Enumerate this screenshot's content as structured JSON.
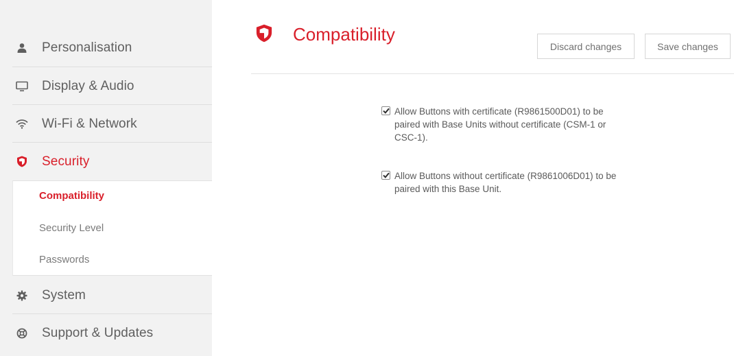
{
  "sidebar": {
    "items": [
      {
        "label": "Personalisation",
        "icon": "person-icon"
      },
      {
        "label": "Display & Audio",
        "icon": "monitor-icon"
      },
      {
        "label": "Wi-Fi & Network",
        "icon": "wifi-icon"
      },
      {
        "label": "Security",
        "icon": "shield-icon"
      },
      {
        "label": "System",
        "icon": "gear-icon"
      },
      {
        "label": "Support & Updates",
        "icon": "lifebuoy-icon"
      }
    ],
    "active": "Security",
    "subitems": [
      {
        "label": "Compatibility"
      },
      {
        "label": "Security Level"
      },
      {
        "label": "Passwords"
      }
    ],
    "active_subitem": "Compatibility"
  },
  "main": {
    "title": "Compatibility",
    "discard_label": "Discard changes",
    "save_label": "Save changes",
    "options": [
      {
        "checked": true,
        "text": "Allow Buttons with certificate (R9861500D01) to be paired with Base Units without certificate (CSM-1 or CSC-1)."
      },
      {
        "checked": true,
        "text": "Allow Buttons without certificate (R9861006D01) to be paired with this Base Unit."
      }
    ]
  },
  "colors": {
    "accent": "#d91f2a",
    "sidebar_bg": "#f2f2f2",
    "text": "#5a5a5a"
  }
}
